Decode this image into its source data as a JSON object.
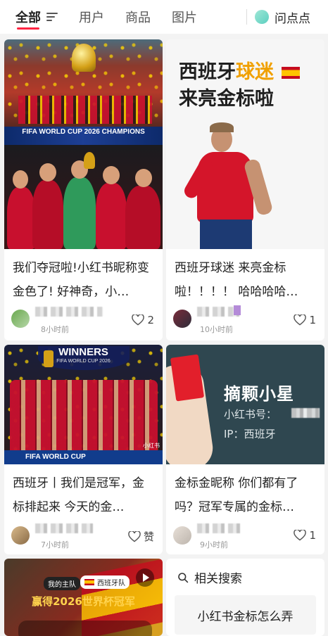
{
  "tabs": [
    {
      "label": "全部",
      "active": true
    },
    {
      "label": "用户",
      "active": false
    },
    {
      "label": "商品",
      "active": false
    },
    {
      "label": "图片",
      "active": false
    }
  ],
  "ask_label": "问点点",
  "accent_color": "#ff2442",
  "cards": [
    {
      "title": "我们夺冠啦!小红书昵称变金色了! 好神奇，小…",
      "time": "8小时前",
      "likes": "2",
      "image_text": "FIFA WORLD CUP 2026 CHAMPIONS"
    },
    {
      "title": "西班牙球迷 来亮金标啦！！！！ 哈哈哈哈…",
      "time": "10小时前",
      "likes": "1",
      "image_text_1": "西班牙",
      "image_text_2": "球迷",
      "image_text_3": "来亮金标啦"
    },
    {
      "title": "西班牙丨我们是冠军，金标排起来 今天的金…",
      "time": "7小时前",
      "likes": "赞",
      "image_text_1": "WINNERS",
      "image_text_2": "FIFA WORLD CUP 2026",
      "image_text_3": "FIFA WORLD CUP",
      "image_text_4": "小红书"
    },
    {
      "title": "金标金昵称 你们都有了吗？冠军专属的金标…",
      "time": "9小时前",
      "likes": "1",
      "image_text_1": "摘颗小星",
      "image_text_2": "小红书号：",
      "image_text_3": "IP：西班牙"
    },
    {
      "image_text_1": "我的主队",
      "image_text_2": "西班牙队",
      "image_text_3": "赢得2026世界杯冠军"
    }
  ],
  "related_search": {
    "header": "相关搜索",
    "items": [
      "小红书金标怎么弄"
    ]
  }
}
